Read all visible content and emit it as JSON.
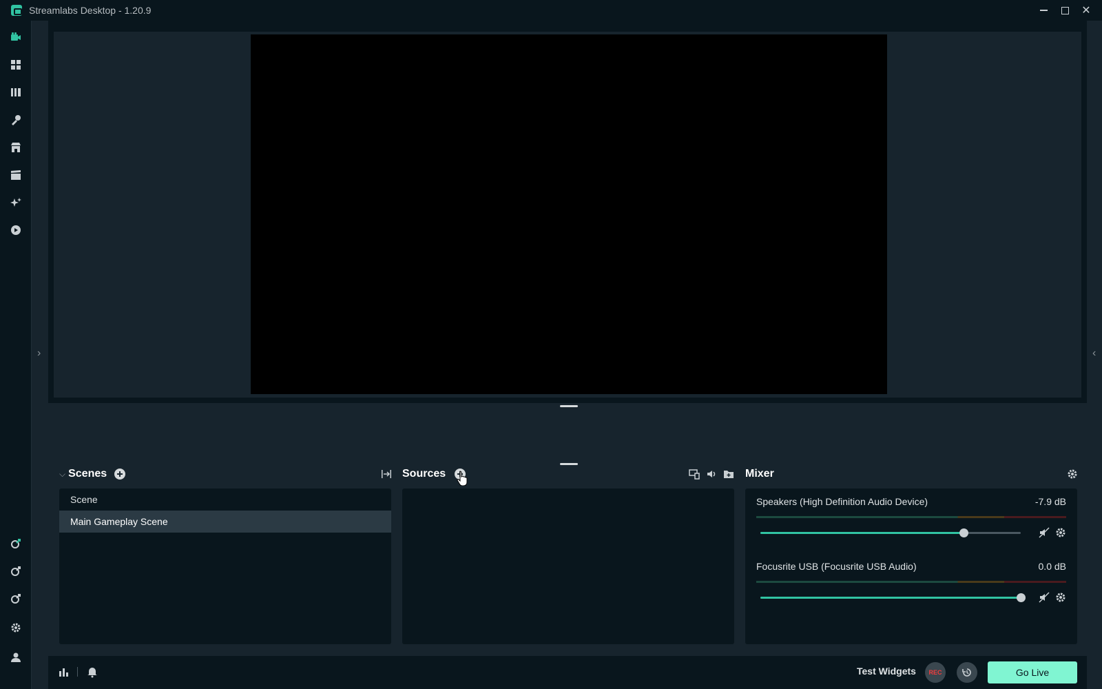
{
  "window": {
    "title": "Streamlabs Desktop - 1.20.9",
    "controls": [
      "minimize-icon",
      "maximize-icon",
      "close-icon"
    ]
  },
  "left_nav": {
    "top_icons": [
      "studio-camera-icon",
      "dashboard-icon",
      "library-icon",
      "themes-icon",
      "store-icon",
      "highlighter-icon",
      "ai-sparkle-icon",
      "play-icon"
    ],
    "bottom_icons": [
      "integration-link-icon",
      "integration-link-icon-2",
      "integration-link-icon-3",
      "settings-gear-icon",
      "account-icon"
    ],
    "active_color": "#31c3a2"
  },
  "scenes": {
    "title": "Scenes",
    "items": [
      {
        "label": "Scene",
        "active": false
      },
      {
        "label": "Main Gameplay Scene",
        "active": true
      }
    ]
  },
  "sources": {
    "title": "Sources",
    "items": []
  },
  "mixer": {
    "title": "Mixer",
    "channels": [
      {
        "name": "Speakers (High Definition Audio Device)",
        "db": "-7.9 dB",
        "volume": 0.78
      },
      {
        "name": "Focusrite USB (Focusrite USB Audio)",
        "db": "0.0 dB",
        "volume": 1.0
      }
    ]
  },
  "footer": {
    "test_widgets": "Test Widgets",
    "rec": "REC",
    "go_live": "Go Live"
  },
  "colors": {
    "accent": "#31c3a2",
    "go_live_bg": "#80f5d2",
    "rec_text": "#ef3d3d",
    "background": "#17242d",
    "panel": "#09161d"
  }
}
